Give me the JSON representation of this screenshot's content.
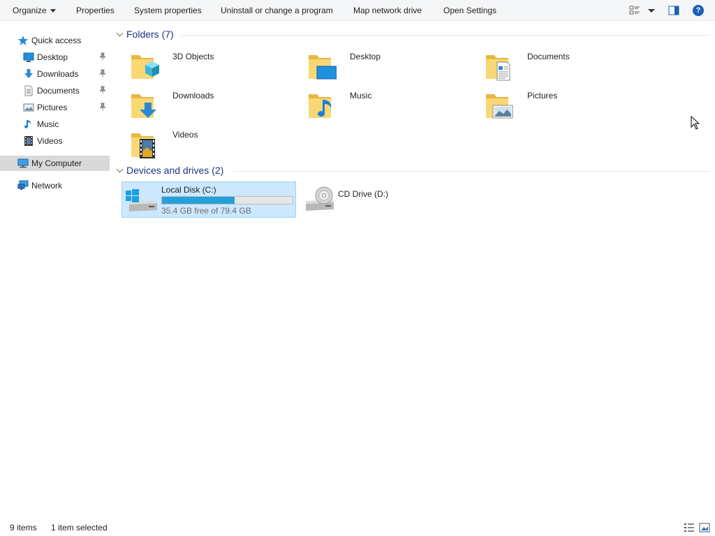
{
  "toolbar": {
    "organize": "Organize",
    "properties": "Properties",
    "system_properties": "System properties",
    "uninstall": "Uninstall or change a program",
    "map_drive": "Map network drive",
    "open_settings": "Open Settings",
    "help_glyph": "?"
  },
  "nav": {
    "quick_access": "Quick access",
    "items": [
      {
        "label": "Desktop",
        "icon": "desktop-icon",
        "pinned": true
      },
      {
        "label": "Downloads",
        "icon": "downloads-icon",
        "pinned": true
      },
      {
        "label": "Documents",
        "icon": "documents-icon",
        "pinned": true
      },
      {
        "label": "Pictures",
        "icon": "pictures-icon",
        "pinned": true
      },
      {
        "label": "Music",
        "icon": "music-icon",
        "pinned": false
      },
      {
        "label": "Videos",
        "icon": "videos-icon",
        "pinned": false
      }
    ],
    "my_computer": "My Computer",
    "network": "Network"
  },
  "folders": {
    "header": "Folders (7)",
    "items": [
      {
        "label": "3D Objects",
        "icon": "3d-objects-folder-icon"
      },
      {
        "label": "Desktop",
        "icon": "desktop-folder-icon"
      },
      {
        "label": "Documents",
        "icon": "documents-folder-icon"
      },
      {
        "label": "Downloads",
        "icon": "downloads-folder-icon"
      },
      {
        "label": "Music",
        "icon": "music-folder-icon"
      },
      {
        "label": "Pictures",
        "icon": "pictures-folder-icon"
      },
      {
        "label": "Videos",
        "icon": "videos-folder-icon"
      }
    ]
  },
  "devices": {
    "header": "Devices and drives (2)",
    "items": [
      {
        "label": "Local Disk (C:)",
        "free": "35.4 GB free of 79.4 GB",
        "used_fraction": 0.554,
        "selected": true
      },
      {
        "label": "CD Drive (D:)",
        "selected": false
      }
    ]
  },
  "status": {
    "items": "9 items",
    "selected": "1 item selected"
  },
  "colors": {
    "selection_bg": "#cce8ff",
    "selection_border": "#99d1ff",
    "usage_bar": "#26a0da",
    "header_text": "#1e3287"
  }
}
